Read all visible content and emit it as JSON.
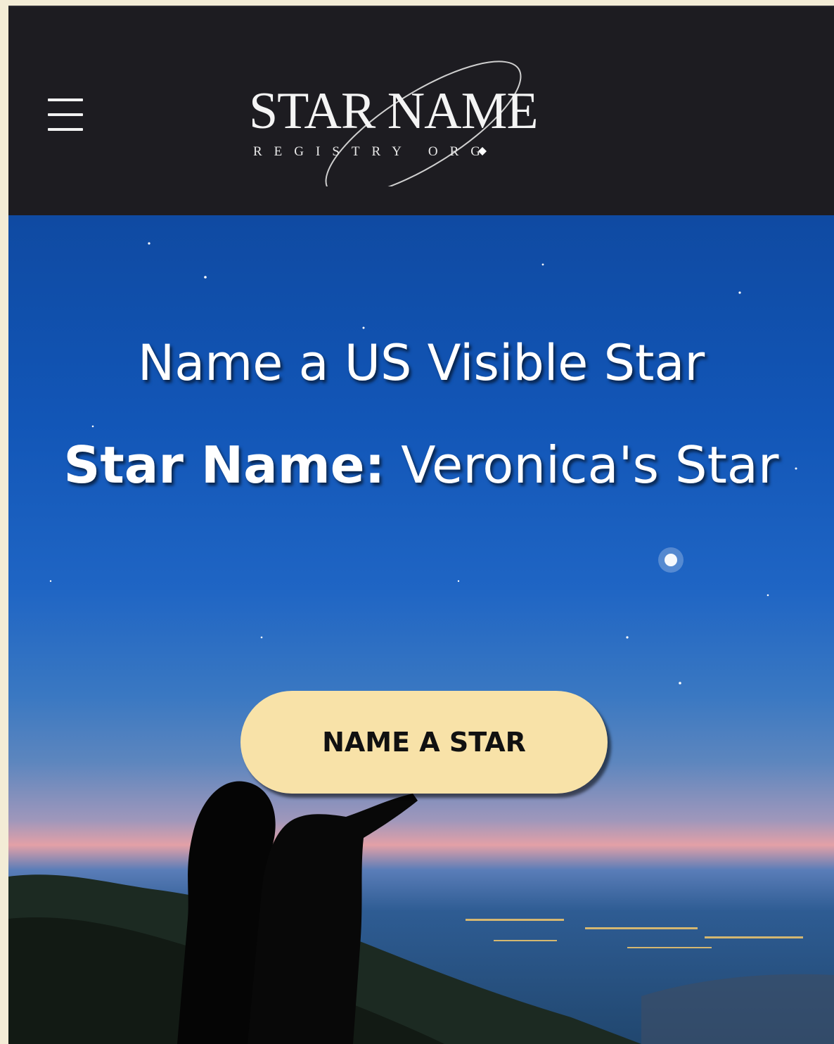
{
  "header": {
    "menu_icon": "hamburger-menu-icon",
    "logo": {
      "main": "STAR NAME",
      "sub": "REGISTRY ORG"
    }
  },
  "hero": {
    "title": "Name a US Visible Star",
    "star_label": "Star Name:",
    "star_value": "Veronica's Star",
    "cta_label": "NAME A STAR"
  },
  "colors": {
    "header_bg": "#1d1c21",
    "sky_top": "#0f4aa2",
    "cta_bg": "#f8e2a8",
    "page_border": "#f3ecd6"
  }
}
